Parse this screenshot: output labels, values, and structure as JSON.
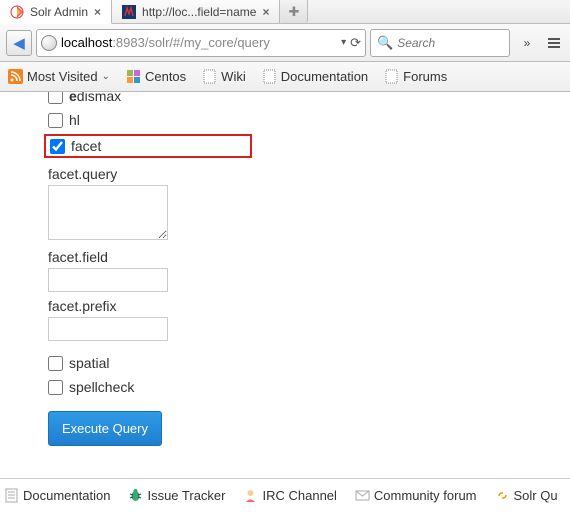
{
  "tabs": [
    {
      "title": "Solr Admin",
      "icon": "solr"
    },
    {
      "title": "http://loc...field=name",
      "icon": "mozilla"
    }
  ],
  "url": {
    "host": "localhost",
    "rest": ":8983/solr/#/my_core/query"
  },
  "search": {
    "placeholder": "Search"
  },
  "bookmarks": {
    "most": "Most Visited",
    "centos": "Centos",
    "wiki": "Wiki",
    "docs": "Documentation",
    "forums": "Forums"
  },
  "form": {
    "edismax": "edismax",
    "hl": "hl",
    "facet": "facet",
    "facet_query": "facet.query",
    "facet_field": "facet.field",
    "facet_prefix": "facet.prefix",
    "spatial": "spatial",
    "spellcheck": "spellcheck",
    "execute": "Execute Query"
  },
  "footer": {
    "doc": "Documentation",
    "issue": "Issue Tracker",
    "irc": "IRC Channel",
    "community": "Community forum",
    "solrq": "Solr Qu"
  }
}
